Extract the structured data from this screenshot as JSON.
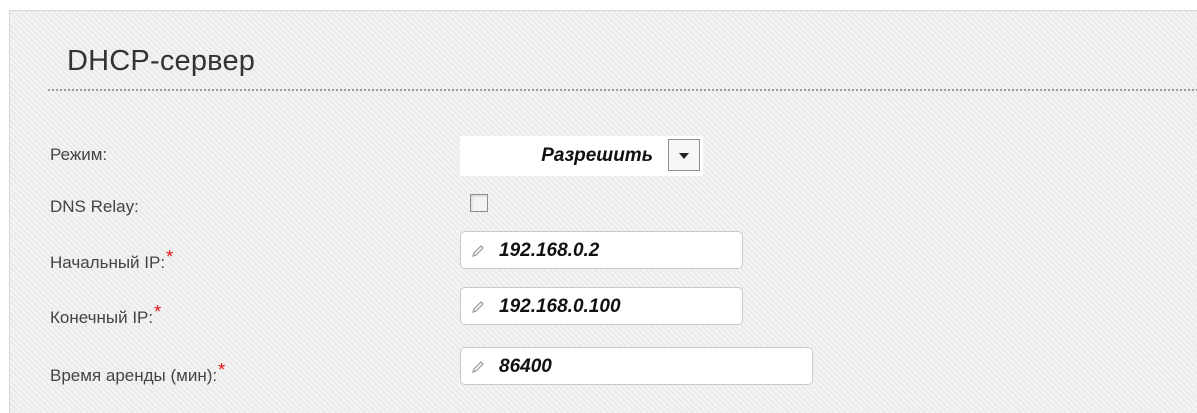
{
  "section": {
    "title": "DHCP-сервер"
  },
  "fields": {
    "mode": {
      "label": "Режим:",
      "value": "Разрешить"
    },
    "dns_relay": {
      "label": "DNS Relay:",
      "checked": false
    },
    "start_ip": {
      "label": "Начальный IP:",
      "required_mark": "*",
      "value": "192.168.0.2"
    },
    "end_ip": {
      "label": "Конечный IP:",
      "required_mark": "*",
      "value": "192.168.0.100"
    },
    "lease_time": {
      "label": "Время аренды (мин):",
      "required_mark": "*",
      "value": "86400"
    }
  },
  "icons": {
    "edit": "pencil-icon",
    "dropdown": "chevron-down-icon"
  },
  "colors": {
    "required": "#e01010",
    "panel_bg": "#eeeeee",
    "text": "#444444"
  }
}
